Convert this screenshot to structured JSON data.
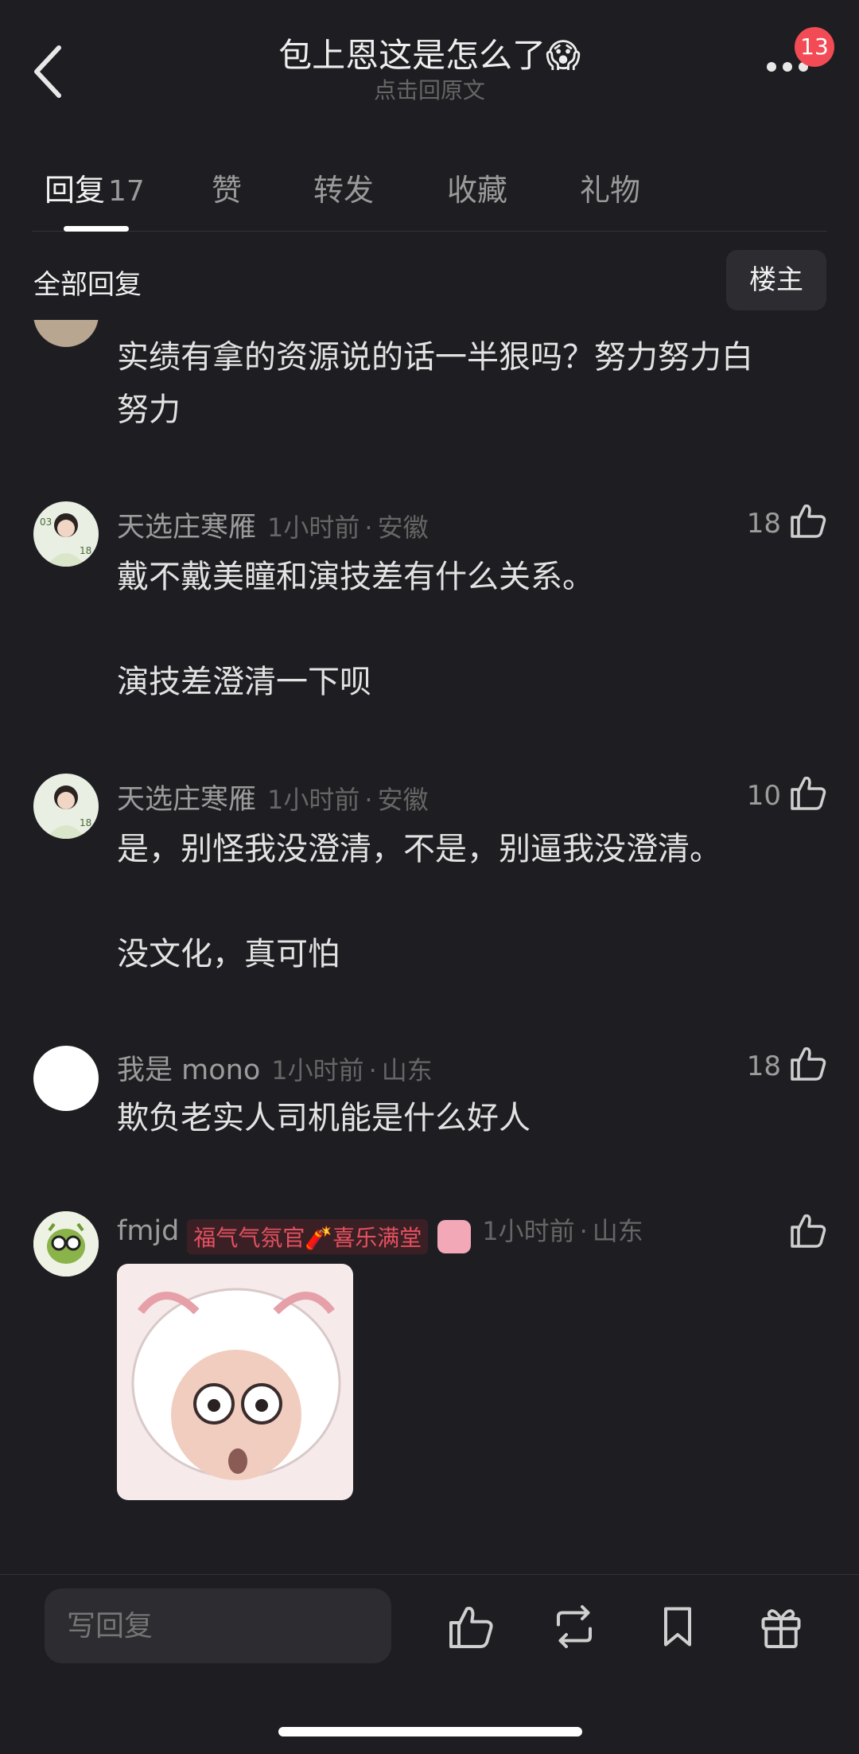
{
  "header": {
    "title": "包上恩这是怎么了",
    "title_emoji": "😱",
    "subtitle": "点击回原文",
    "notification_count": "13"
  },
  "tabs": [
    {
      "label": "回复",
      "count": "17",
      "active": true
    },
    {
      "label": "赞"
    },
    {
      "label": "转发"
    },
    {
      "label": "收藏"
    },
    {
      "label": "礼物"
    }
  ],
  "filter": {
    "label": "全部回复",
    "op_button": "楼主"
  },
  "comments": [
    {
      "username": "",
      "text": "实绩有拿的资源说的话一半狠吗？努力努力白\n努力"
    },
    {
      "username": "天选庄寒雁",
      "time": "1小时前",
      "location": "安徽",
      "likes": "18",
      "text": "戴不戴美瞳和演技差有什么关系。\n\n演技差澄清一下呗"
    },
    {
      "username": "天选庄寒雁",
      "time": "1小时前",
      "location": "安徽",
      "likes": "10",
      "text": "是，别怪我没澄清，不是，别逼我没澄清。\n\n没文化，真可怕"
    },
    {
      "username": "我是 mono",
      "time": "1小时前",
      "location": "山东",
      "likes": "18",
      "text": "欺负老实人司机能是什么好人"
    },
    {
      "username": "fmjd",
      "badge": "福气气氛官🧨喜乐满堂",
      "time": "1小时前",
      "location": "山东",
      "likes": ""
    }
  ],
  "bottom_bar": {
    "reply_placeholder": "写回复"
  },
  "colors": {
    "background": "#1e1e22",
    "badge": "#f24b55",
    "medal_text": "#e5505f"
  }
}
